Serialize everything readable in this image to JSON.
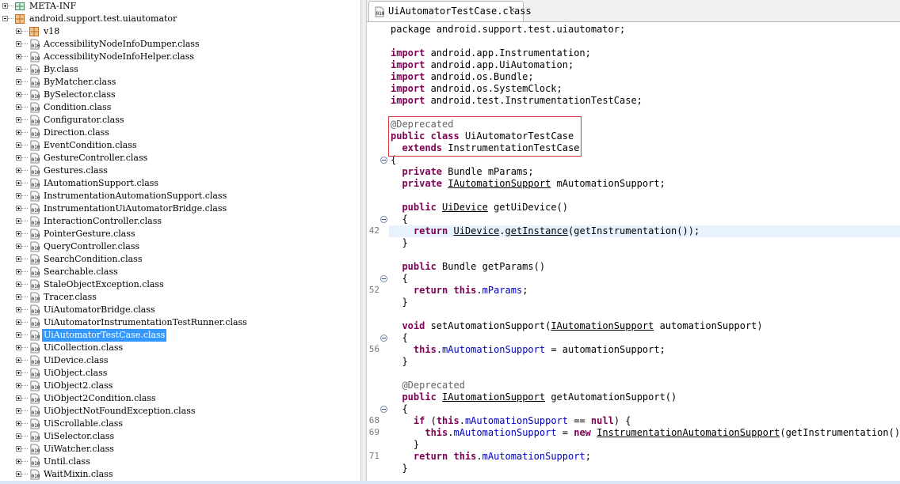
{
  "tree": {
    "packages": [
      {
        "label": "META-INF",
        "expanded": false
      },
      {
        "label": "android.support.test.uiautomator",
        "expanded": true
      }
    ],
    "subpackage": "v18",
    "classes": [
      "AccessibilityNodeInfoDumper.class",
      "AccessibilityNodeInfoHelper.class",
      "By.class",
      "ByMatcher.class",
      "BySelector.class",
      "Condition.class",
      "Configurator.class",
      "Direction.class",
      "EventCondition.class",
      "GestureController.class",
      "Gestures.class",
      "IAutomationSupport.class",
      "InstrumentationAutomationSupport.class",
      "InstrumentationUiAutomatorBridge.class",
      "InteractionController.class",
      "PointerGesture.class",
      "QueryController.class",
      "SearchCondition.class",
      "Searchable.class",
      "StaleObjectException.class",
      "Tracer.class",
      "UiAutomatorBridge.class",
      "UiAutomatorInstrumentationTestRunner.class",
      "UiAutomatorTestCase.class",
      "UiCollection.class",
      "UiDevice.class",
      "UiObject.class",
      "UiObject2.class",
      "UiObject2Condition.class",
      "UiObjectNotFoundException.class",
      "UiScrollable.class",
      "UiSelector.class",
      "UiWatcher.class",
      "Until.class",
      "WaitMixin.class"
    ],
    "selected": "UiAutomatorTestCase.class"
  },
  "editor": {
    "tab_label": "UiAutomatorTestCase.class",
    "tab_close": "✕",
    "line_numbers": [
      {
        "text": "42",
        "line": 17
      },
      {
        "text": "52",
        "line": 22
      },
      {
        "text": "56",
        "line": 27
      },
      {
        "text": "68",
        "line": 33
      },
      {
        "text": "69",
        "line": 34
      },
      {
        "text": "71",
        "line": 36
      }
    ],
    "fold_markers": [
      11,
      16,
      21,
      26,
      32
    ],
    "current_line": 17,
    "lines": [
      [
        [
          "package android.support.test.uiautomator;",
          ""
        ]
      ],
      [],
      [
        [
          "import",
          "kw"
        ],
        [
          " android.app.Instrumentation;",
          ""
        ]
      ],
      [
        [
          "import",
          "kw"
        ],
        [
          " android.app.UiAutomation;",
          ""
        ]
      ],
      [
        [
          "import",
          "kw"
        ],
        [
          " android.os.Bundle;",
          ""
        ]
      ],
      [
        [
          "import",
          "kw"
        ],
        [
          " android.os.SystemClock;",
          ""
        ]
      ],
      [
        [
          "import",
          "kw"
        ],
        [
          " android.test.InstrumentationTestCase;",
          ""
        ]
      ],
      [],
      [
        [
          "@Deprecated",
          "ann"
        ]
      ],
      [
        [
          "public",
          "kw"
        ],
        [
          " ",
          ""
        ],
        [
          "class",
          "kw"
        ],
        [
          " UiAutomatorTestCase",
          ""
        ]
      ],
      [
        [
          "  ",
          ""
        ],
        [
          "extends",
          "kw"
        ],
        [
          " InstrumentationTestCase",
          ""
        ]
      ],
      [
        [
          "{",
          ""
        ]
      ],
      [
        [
          "  ",
          ""
        ],
        [
          "private",
          "kw"
        ],
        [
          " Bundle mParams;",
          ""
        ]
      ],
      [
        [
          "  ",
          ""
        ],
        [
          "private",
          "kw"
        ],
        [
          " ",
          ""
        ],
        [
          "IAutomationSupport",
          "ul"
        ],
        [
          " mAutomationSupport;",
          ""
        ]
      ],
      [],
      [
        [
          "  ",
          ""
        ],
        [
          "public",
          "kw"
        ],
        [
          " ",
          ""
        ],
        [
          "UiDevice",
          "ul"
        ],
        [
          " getUiDevice()",
          ""
        ]
      ],
      [
        [
          "  {",
          ""
        ]
      ],
      [
        [
          "    ",
          ""
        ],
        [
          "return",
          "kw"
        ],
        [
          " ",
          ""
        ],
        [
          "UiDevice",
          "ul"
        ],
        [
          ".",
          ""
        ],
        [
          "getInstance",
          "ul"
        ],
        [
          "(getInstrumentation());",
          ""
        ]
      ],
      [
        [
          "  }",
          ""
        ]
      ],
      [],
      [
        [
          "  ",
          ""
        ],
        [
          "public",
          "kw"
        ],
        [
          " Bundle getParams()",
          ""
        ]
      ],
      [
        [
          "  {",
          ""
        ]
      ],
      [
        [
          "    ",
          ""
        ],
        [
          "return",
          "kw"
        ],
        [
          " ",
          ""
        ],
        [
          "this",
          "kw"
        ],
        [
          ".",
          ""
        ],
        [
          "mParams",
          "fld"
        ],
        [
          ";",
          ""
        ]
      ],
      [
        [
          "  }",
          ""
        ]
      ],
      [],
      [
        [
          "  ",
          ""
        ],
        [
          "void",
          "kw"
        ],
        [
          " setAutomationSupport(",
          ""
        ],
        [
          "IAutomationSupport",
          "ul"
        ],
        [
          " automationSupport)",
          ""
        ]
      ],
      [
        [
          "  {",
          ""
        ]
      ],
      [
        [
          "    ",
          ""
        ],
        [
          "this",
          "kw"
        ],
        [
          ".",
          ""
        ],
        [
          "mAutomationSupport",
          "fld"
        ],
        [
          " = automationSupport;",
          ""
        ]
      ],
      [
        [
          "  }",
          ""
        ]
      ],
      [],
      [
        [
          "  ",
          ""
        ],
        [
          "@Deprecated",
          "ann"
        ]
      ],
      [
        [
          "  ",
          ""
        ],
        [
          "public",
          "kw"
        ],
        [
          " ",
          ""
        ],
        [
          "IAutomationSupport",
          "ul"
        ],
        [
          " getAutomationSupport()",
          ""
        ]
      ],
      [
        [
          "  {",
          ""
        ]
      ],
      [
        [
          "    ",
          ""
        ],
        [
          "if",
          "kw"
        ],
        [
          " (",
          ""
        ],
        [
          "this",
          "kw"
        ],
        [
          ".",
          ""
        ],
        [
          "mAutomationSupport",
          "fld"
        ],
        [
          " == ",
          ""
        ],
        [
          "null",
          "kw"
        ],
        [
          ") {",
          ""
        ]
      ],
      [
        [
          "      ",
          ""
        ],
        [
          "this",
          "kw"
        ],
        [
          ".",
          ""
        ],
        [
          "mAutomationSupport",
          "fld"
        ],
        [
          " = ",
          ""
        ],
        [
          "new",
          "kw"
        ],
        [
          " ",
          ""
        ],
        [
          "InstrumentationAutomationSupport",
          "ul"
        ],
        [
          "(getInstrumentation());",
          ""
        ]
      ],
      [
        [
          "    }",
          ""
        ]
      ],
      [
        [
          "    ",
          ""
        ],
        [
          "return",
          "kw"
        ],
        [
          " ",
          ""
        ],
        [
          "this",
          "kw"
        ],
        [
          ".",
          ""
        ],
        [
          "mAutomationSupport",
          "fld"
        ],
        [
          ";",
          ""
        ]
      ],
      [
        [
          "  }",
          ""
        ]
      ]
    ]
  },
  "colors": {
    "keyword": "#7f0055",
    "annotation": "#646464",
    "field": "#0000c0",
    "selection": "#3399ff",
    "highlight_box": "#d93a3a"
  },
  "icons": {
    "package": "package-icon",
    "class_file": "class-file-icon",
    "expander": "tree-expander-icon",
    "fold": "fold-collapse-icon"
  }
}
